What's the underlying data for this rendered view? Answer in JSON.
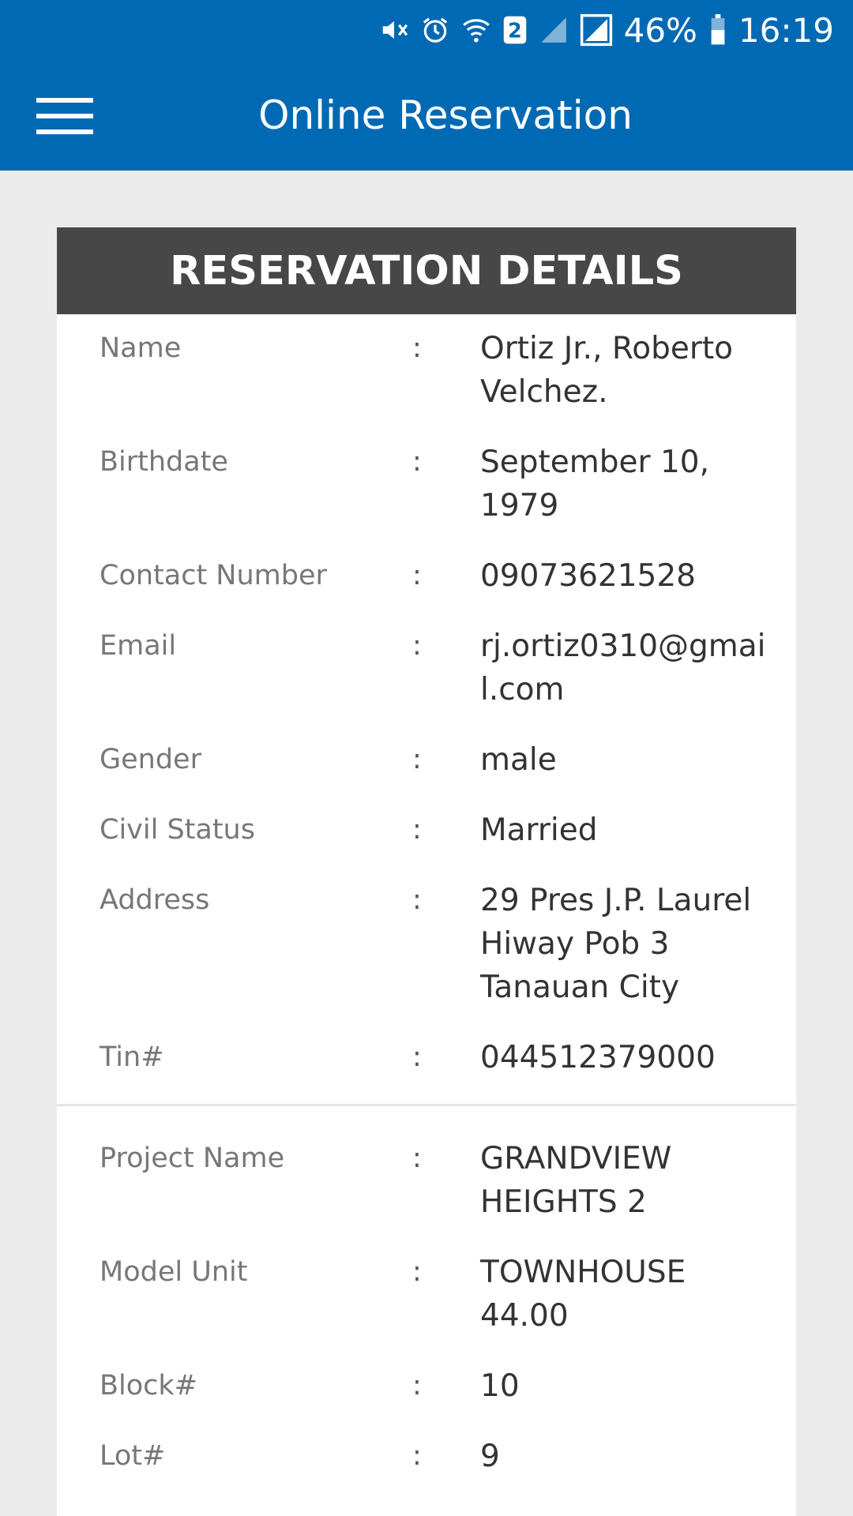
{
  "status_bar": {
    "battery": "46%",
    "time": "16:19",
    "sim_badge": "2",
    "icons": [
      "mute-icon",
      "alarm-icon",
      "wifi-icon",
      "sim-2-icon",
      "signal-icon",
      "signal-box-icon",
      "battery-icon"
    ]
  },
  "app_bar": {
    "title": "Online Reservation",
    "menu_icon": "hamburger-menu-icon"
  },
  "card": {
    "title": "RESERVATION DETAILS",
    "separator": ":",
    "personal": [
      {
        "label": "Name",
        "value": "Ortiz Jr., Roberto Velchez."
      },
      {
        "label": "Birthdate",
        "value": "September 10, 1979"
      },
      {
        "label": "Contact Number",
        "value": "09073621528"
      },
      {
        "label": "Email",
        "value": "rj.ortiz0310@gmail.com"
      },
      {
        "label": "Gender",
        "value": "male"
      },
      {
        "label": "Civil Status",
        "value": "Married"
      },
      {
        "label": "Address",
        "value": "29 Pres J.P. Laurel Hiway Pob 3 Tanauan City"
      },
      {
        "label": "Tin#",
        "value": "044512379000"
      }
    ],
    "property": [
      {
        "label": "Project Name",
        "value": "GRANDVIEW HEIGHTS 2"
      },
      {
        "label": "Model Unit",
        "value": "TOWNHOUSE 44.00"
      },
      {
        "label": "Block#",
        "value": "10"
      },
      {
        "label": "Lot#",
        "value": "9"
      }
    ]
  },
  "colors": {
    "app_bar": "#0069b4",
    "card_header": "#474747",
    "background": "#ebebeb"
  }
}
